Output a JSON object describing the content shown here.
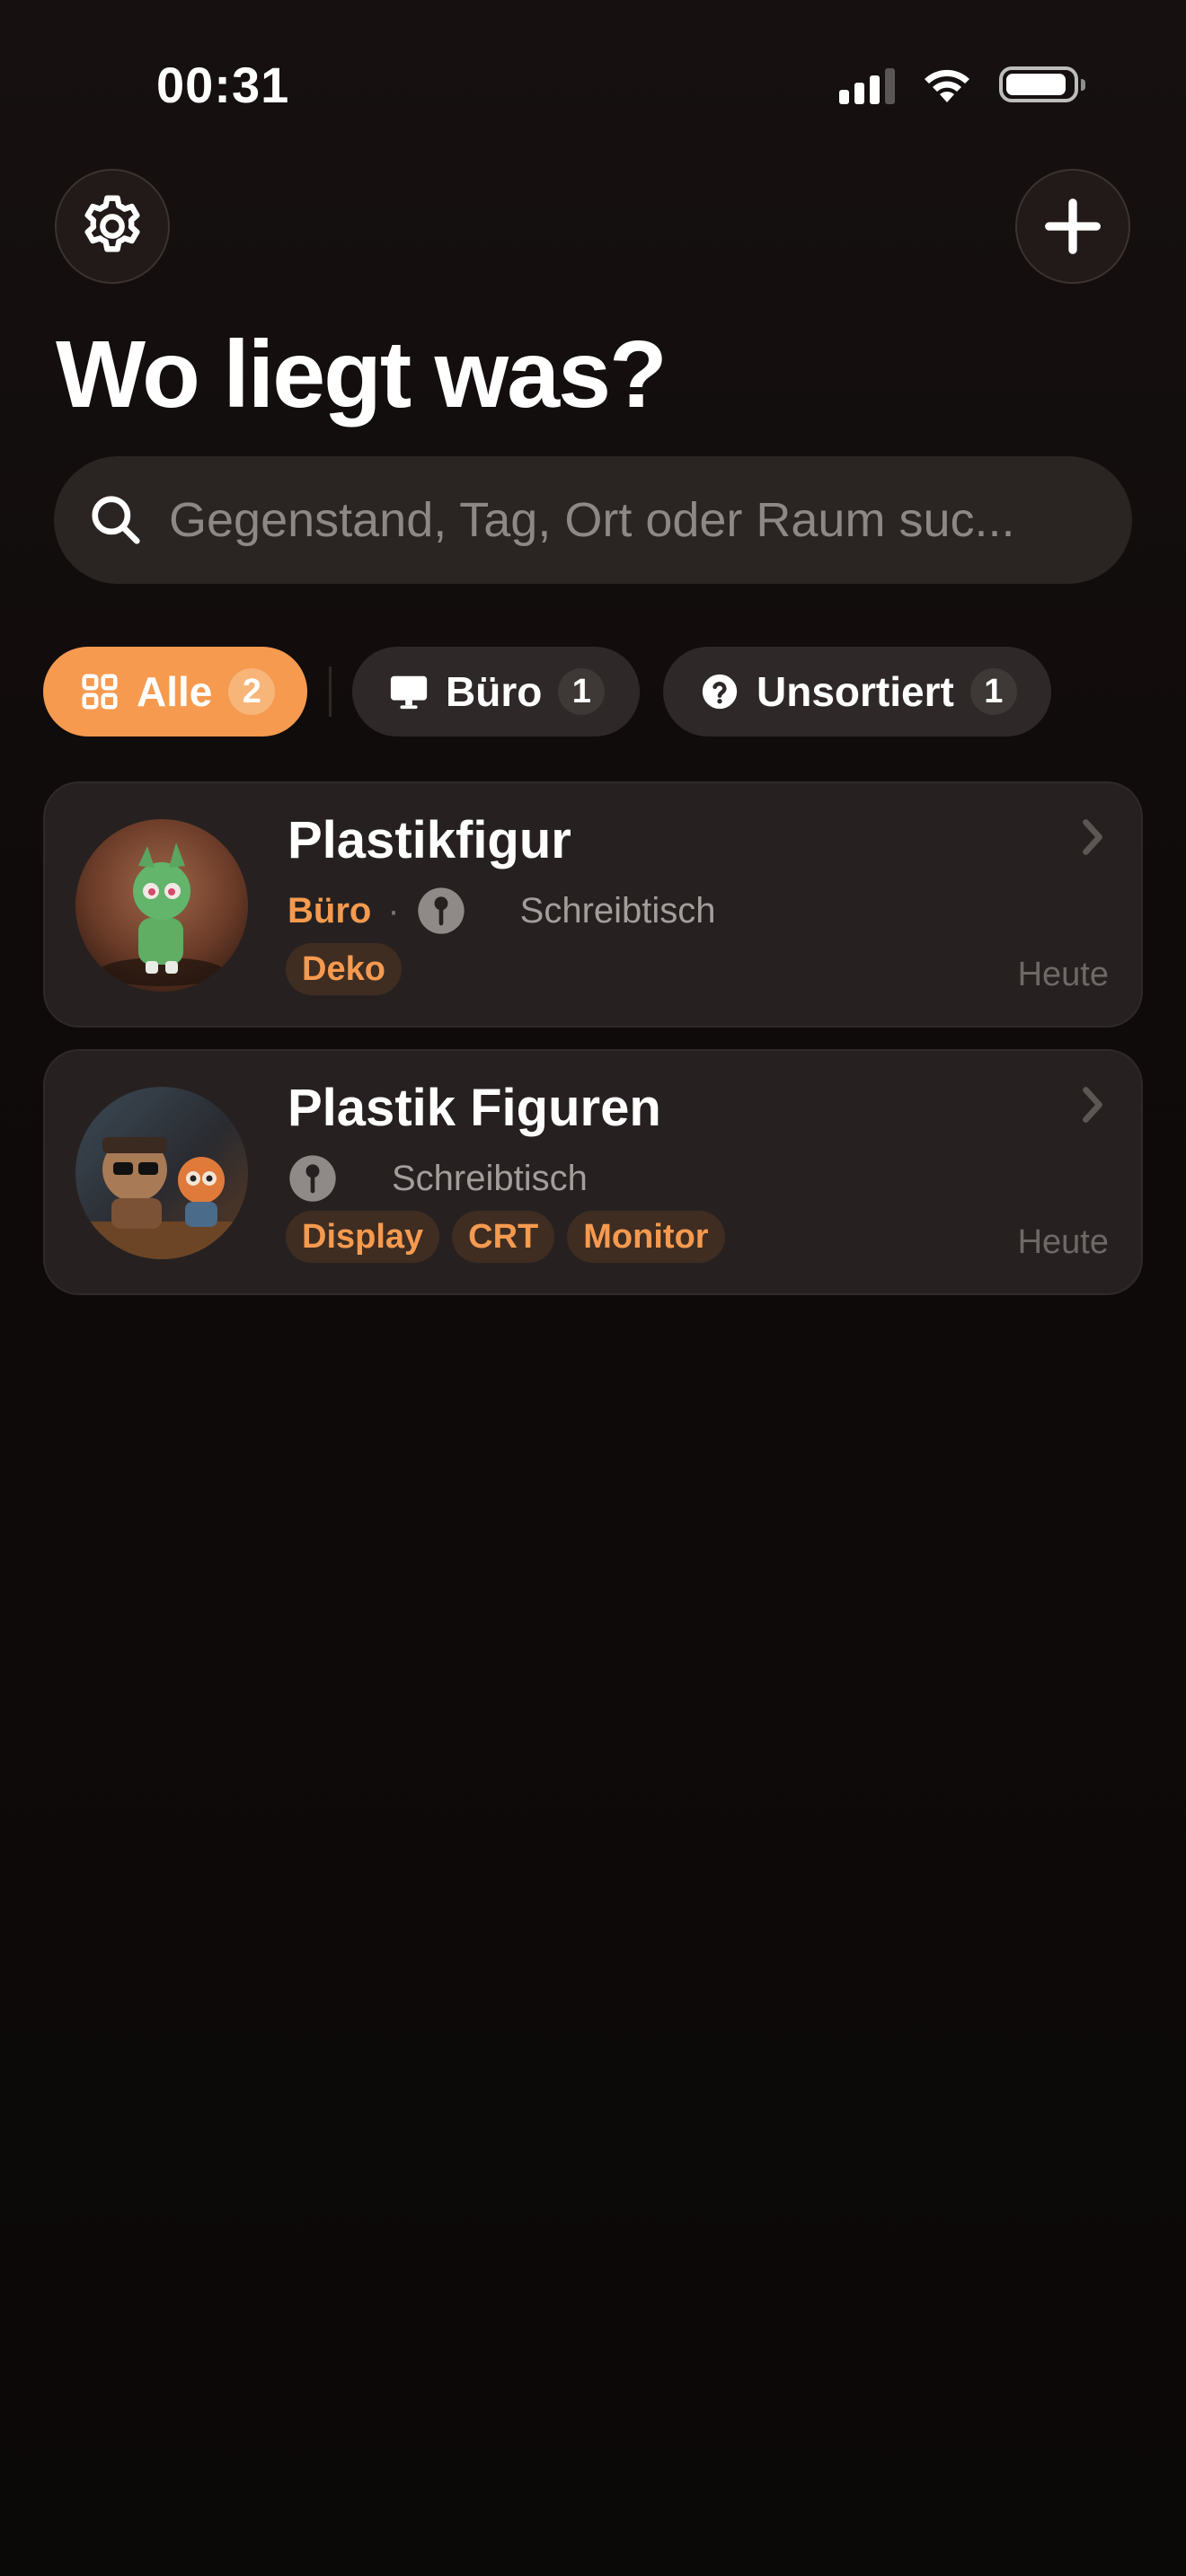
{
  "status_bar": {
    "time": "00:31"
  },
  "header": {
    "title": "Wo liegt was?",
    "settings_icon": "gear-icon",
    "add_icon": "plus-icon"
  },
  "search": {
    "placeholder": "Gegenstand, Tag, Ort oder Raum suc...",
    "value": ""
  },
  "filters": [
    {
      "label": "Alle",
      "count": "2",
      "icon": "grid-icon",
      "selected": true
    },
    {
      "label": "Büro",
      "count": "1",
      "icon": "monitor-icon",
      "selected": false
    },
    {
      "label": "Unsortiert",
      "count": "1",
      "icon": "question-circle-icon",
      "selected": false
    }
  ],
  "items": [
    {
      "title": "Plastikfigur",
      "room": "Büro",
      "place": "Schreibtisch",
      "tags": [
        "Deko"
      ],
      "date": "Heute"
    },
    {
      "title": "Plastik Figuren",
      "room": "",
      "place": "Schreibtisch",
      "tags": [
        "Display",
        "CRT",
        "Monitor"
      ],
      "date": "Heute"
    }
  ],
  "colors": {
    "accent": "#f59a4f",
    "background": "#110c0c",
    "card": "#262120",
    "tag_background": "#3f2d22"
  }
}
